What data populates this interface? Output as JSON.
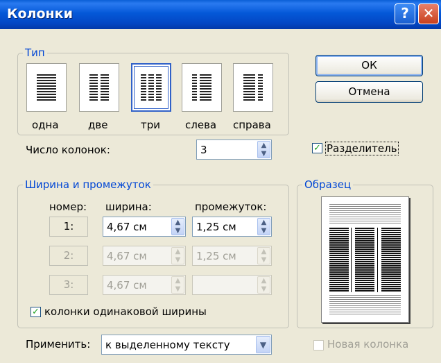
{
  "window": {
    "title": "Колонки",
    "help_glyph": "?",
    "close_glyph": "✕"
  },
  "type_group": {
    "label": "Тип",
    "presets": [
      {
        "label": "одна",
        "selected": false
      },
      {
        "label": "две",
        "selected": false
      },
      {
        "label": "три",
        "selected": true
      },
      {
        "label": "слева",
        "selected": false
      },
      {
        "label": "справа",
        "selected": false
      }
    ]
  },
  "buttons": {
    "ok": "ОК",
    "cancel": "Отмена"
  },
  "num_columns": {
    "label": "Число колонок:",
    "value": "3"
  },
  "separator": {
    "label": "Разделитель",
    "checked": true
  },
  "width_group": {
    "label": "Ширина и промежуток",
    "col_number_header": "номер:",
    "width_header": "ширина:",
    "spacing_header": "промежуток:",
    "rows": [
      {
        "num": "1:",
        "width": "4,67 см",
        "spacing": "1,25 см",
        "enabled": true
      },
      {
        "num": "2:",
        "width": "4,67 см",
        "spacing": "1,25 см",
        "enabled": false
      },
      {
        "num": "3:",
        "width": "4,67 см",
        "spacing": "",
        "enabled": false
      }
    ],
    "equal_width": {
      "label": "колонки одинаковой ширины",
      "checked": true
    }
  },
  "preview": {
    "label": "Образец"
  },
  "apply": {
    "label": "Применить:",
    "value": "к выделенному тексту"
  },
  "new_column": {
    "label": "Новая колонка",
    "checked": false,
    "enabled": false
  },
  "icons": {
    "spin_up": "▲",
    "spin_down": "▼",
    "dropdown": "▼",
    "check": "✓"
  }
}
